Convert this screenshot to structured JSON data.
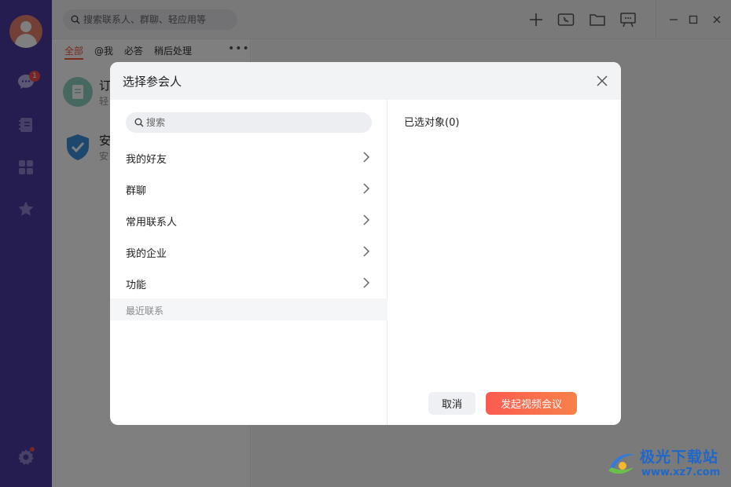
{
  "nav": {
    "messages_badge": "1",
    "icons": [
      "user-avatar",
      "chat-icon",
      "contacts-icon",
      "apps-icon",
      "favorites-icon",
      "settings-icon"
    ]
  },
  "topbar": {
    "search_placeholder": "搜索联系人、群聊、轻应用等",
    "icons": [
      "plus-icon",
      "video-call-icon",
      "folder-icon",
      "presentation-icon"
    ],
    "window_controls": [
      "minimize-icon",
      "maximize-icon",
      "close-icon"
    ]
  },
  "chat_list": {
    "tabs": [
      "全部",
      "@我",
      "必答",
      "稍后处理"
    ],
    "active_tab": "全部",
    "items": [
      {
        "title": "订",
        "subtitle": "轻"
      },
      {
        "title": "安",
        "subtitle": "安"
      }
    ]
  },
  "dialog": {
    "title": "选择参会人",
    "search_placeholder": "搜索",
    "categories": [
      {
        "label": "我的好友"
      },
      {
        "label": "群聊"
      },
      {
        "label": "常用联系人"
      },
      {
        "label": "我的企业"
      },
      {
        "label": "功能"
      }
    ],
    "recent_label": "最近联系",
    "selected_label": "已选对象(0)",
    "cancel_label": "取消",
    "start_label": "发起视频会议"
  },
  "watermark": {
    "name": "极光下载站",
    "url": "www.xz7.com"
  },
  "colors": {
    "rail": "#4a3aa0",
    "accent": "#f05a3a",
    "primary_button_start": "#fb5b50",
    "primary_button_end": "#f7814a",
    "badge": "#f04b4b"
  }
}
